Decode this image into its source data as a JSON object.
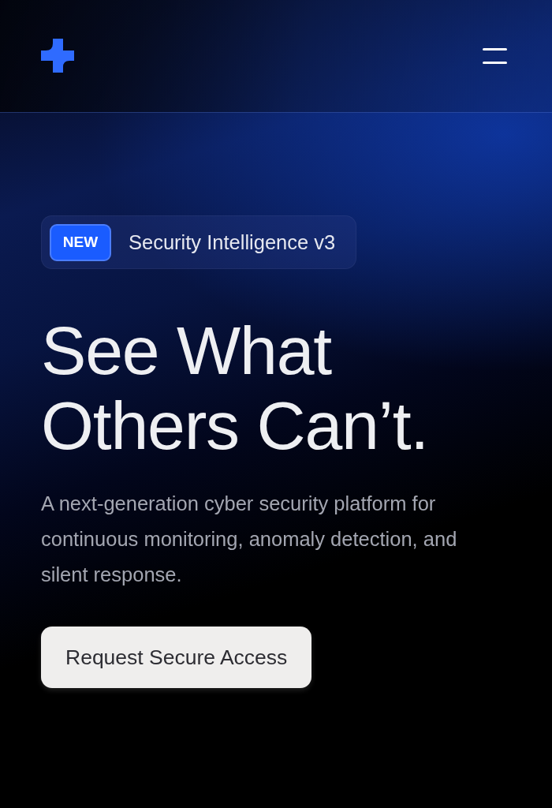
{
  "badge": {
    "tag": "NEW",
    "label": "Security Intelligence v3"
  },
  "hero": {
    "title": "See What Others Can’t.",
    "description": "A next-generation cyber security platform for continuous monitoring, anomaly detection, and silent response.",
    "cta": "Request Secure Access"
  }
}
